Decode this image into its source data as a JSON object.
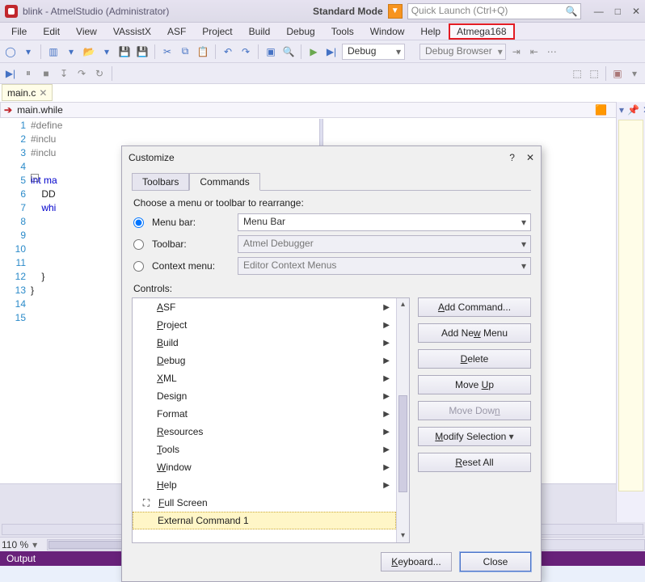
{
  "window": {
    "title": "blink - AtmelStudio (Administrator)",
    "standard_mode": "Standard Mode",
    "quick_launch_placeholder": "Quick Launch (Ctrl+Q)"
  },
  "menus": [
    "File",
    "Edit",
    "View",
    "VAssistX",
    "ASF",
    "Project",
    "Build",
    "Debug",
    "Tools",
    "Window",
    "Help",
    "Atmega168"
  ],
  "toolbar": {
    "config": "Debug",
    "debug_browser": "Debug Browser"
  },
  "editor": {
    "tab": "main.c",
    "nav": "main.while",
    "lines": [
      {
        "n": 1,
        "t": "#define",
        "cls": "pp"
      },
      {
        "n": 2,
        "t": "#inclu",
        "cls": "pp"
      },
      {
        "n": 3,
        "t": "#inclu",
        "cls": "pp"
      },
      {
        "n": 4,
        "t": "",
        "cls": ""
      },
      {
        "n": 5,
        "t": "int ma",
        "cls": "kw",
        "pre": ""
      },
      {
        "n": 6,
        "t": "    DD",
        "cls": ""
      },
      {
        "n": 7,
        "t": "    whi",
        "cls": "kw"
      },
      {
        "n": 8,
        "t": "",
        "cls": ""
      },
      {
        "n": 9,
        "t": "",
        "cls": ""
      },
      {
        "n": 10,
        "t": "",
        "cls": ""
      },
      {
        "n": 11,
        "t": "",
        "cls": ""
      },
      {
        "n": 12,
        "t": "    }",
        "cls": ""
      },
      {
        "n": 13,
        "t": "}",
        "cls": ""
      },
      {
        "n": 14,
        "t": "",
        "cls": ""
      },
      {
        "n": 15,
        "t": "",
        "cls": ""
      }
    ],
    "zoom": "110 %"
  },
  "status": {
    "output": "Output"
  },
  "dialog": {
    "title": "Customize",
    "tabs": {
      "toolbars": "Toolbars",
      "commands": "Commands"
    },
    "choose": "Choose a menu or toolbar to rearrange:",
    "radio": {
      "menubar": "Menu bar:",
      "toolbar": "Toolbar:",
      "context": "Context menu:"
    },
    "selects": {
      "menubar": "Menu Bar",
      "toolbar": "Atmel Debugger",
      "context": "Editor Context Menus"
    },
    "controls_label": "Controls:",
    "menu_items": [
      {
        "label": "ASF",
        "u": "A",
        "arrow": true
      },
      {
        "label": "Project",
        "u": "P",
        "arrow": true
      },
      {
        "label": "Build",
        "u": "B",
        "arrow": true
      },
      {
        "label": "Debug",
        "u": "D",
        "arrow": true
      },
      {
        "label": "XML",
        "u": "X",
        "arrow": true
      },
      {
        "label": "Design",
        "u": "",
        "arrow": true
      },
      {
        "label": "Format",
        "u": "",
        "arrow": true
      },
      {
        "label": "Resources",
        "u": "R",
        "arrow": true
      },
      {
        "label": "Tools",
        "u": "T",
        "arrow": true
      },
      {
        "label": "Window",
        "u": "W",
        "arrow": true
      },
      {
        "label": "Help",
        "u": "H",
        "arrow": true
      }
    ],
    "fullscreen": "Full Screen",
    "ext_cmd": "External Command 1",
    "buttons": {
      "add_command": "Add Command...",
      "add_menu": "Add New Menu",
      "delete": "Delete",
      "move_up": "Move Up",
      "move_down": "Move Down",
      "modify": "Modify Selection",
      "reset": "Reset All",
      "keyboard": "Keyboard...",
      "close": "Close"
    }
  }
}
